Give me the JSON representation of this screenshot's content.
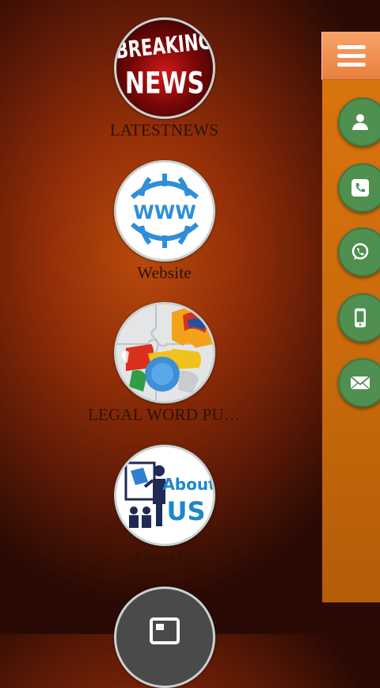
{
  "tiles": [
    {
      "label": "LATESTNEWS",
      "icon": "breaking-news-icon",
      "icon_text_1": "BREAKING",
      "icon_text_2": "NEWS"
    },
    {
      "label": "Website",
      "icon": "www-globe-icon",
      "icon_text_1": "WWW"
    },
    {
      "label": "LEGAL WORD PU…",
      "icon": "puzzle-icon"
    },
    {
      "label": "About Us",
      "icon": "about-us-icon",
      "icon_text_1": "About",
      "icon_text_2": "US"
    },
    {
      "label": "",
      "icon": "news-icon"
    }
  ],
  "side_panel": {
    "menu_icon": "hamburger-menu-icon",
    "buttons": [
      {
        "name": "contact",
        "icon": "person-icon"
      },
      {
        "name": "call",
        "icon": "phone-icon"
      },
      {
        "name": "whatsapp",
        "icon": "whatsapp-icon"
      },
      {
        "name": "mobile",
        "icon": "mobile-icon"
      },
      {
        "name": "email",
        "icon": "envelope-icon"
      }
    ]
  },
  "colors": {
    "accent_orange": "#e9803c",
    "fab_green": "#4f8f50",
    "background": "#952f08"
  }
}
